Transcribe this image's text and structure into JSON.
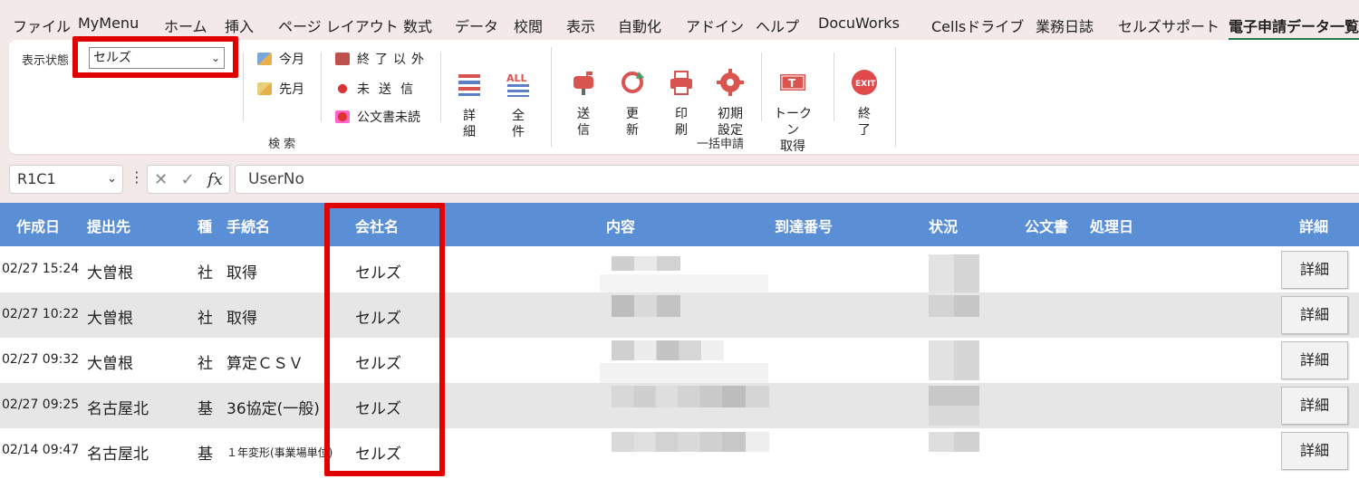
{
  "menu": [
    "ファイル",
    "MyMenu",
    "ホーム",
    "挿入",
    "ページ レイアウト",
    "数式",
    "データ",
    "校閲",
    "表示",
    "自動化",
    "アドイン",
    "ヘルプ",
    "DocuWorks",
    "Cellsドライブ",
    "業務日誌",
    "セルズサポート",
    "電子申請データ一覧"
  ],
  "ribbon": {
    "status_label": "表示状態",
    "status_value": "セルズ",
    "search_buttons": [
      "今月",
      "先月",
      "終了以外",
      "未送信",
      "公文書未読"
    ],
    "detail_label": "詳\n細",
    "all_label": "全\n件",
    "search_group": "検 索",
    "send_label": "送\n信",
    "update_label": "更\n新",
    "print_label": "印\n刷",
    "settings_label": "初期\n設定",
    "token_label": "トークン\n取得",
    "exit_label": "終\n了",
    "bulk_group": "一括申請"
  },
  "formula_bar": {
    "name_box": "R1C1",
    "formula": "UserNo"
  },
  "table": {
    "headers": [
      "作成日",
      "提出先",
      "種",
      "手続名",
      "会社名",
      "内容",
      "到達番号",
      "状況",
      "公文書",
      "処理日",
      "詳細"
    ],
    "rows": [
      {
        "date": "02/27 15:24",
        "dest": "大曽根",
        "kind": "社",
        "proc": "取得",
        "company": "セルズ",
        "detail": "詳細"
      },
      {
        "date": "02/27 10:22",
        "dest": "大曽根",
        "kind": "社",
        "proc": "取得",
        "company": "セルズ",
        "detail": "詳細"
      },
      {
        "date": "02/27 09:32",
        "dest": "大曽根",
        "kind": "社",
        "proc": "算定ＣＳＶ",
        "company": "セルズ",
        "detail": "詳細"
      },
      {
        "date": "02/27 09:25",
        "dest": "名古屋北",
        "kind": "基",
        "proc": "36協定(一般)",
        "company": "セルズ",
        "detail": "詳細"
      },
      {
        "date": "02/14 09:47",
        "dest": "名古屋北",
        "kind": "基",
        "proc": "１年変形(事業場単位)",
        "company": "セルズ",
        "detail": "詳細"
      }
    ]
  },
  "colors": {
    "header_bg": "#5a8fd6",
    "highlight": "#e00000",
    "window_bg": "#f3e9e9"
  }
}
